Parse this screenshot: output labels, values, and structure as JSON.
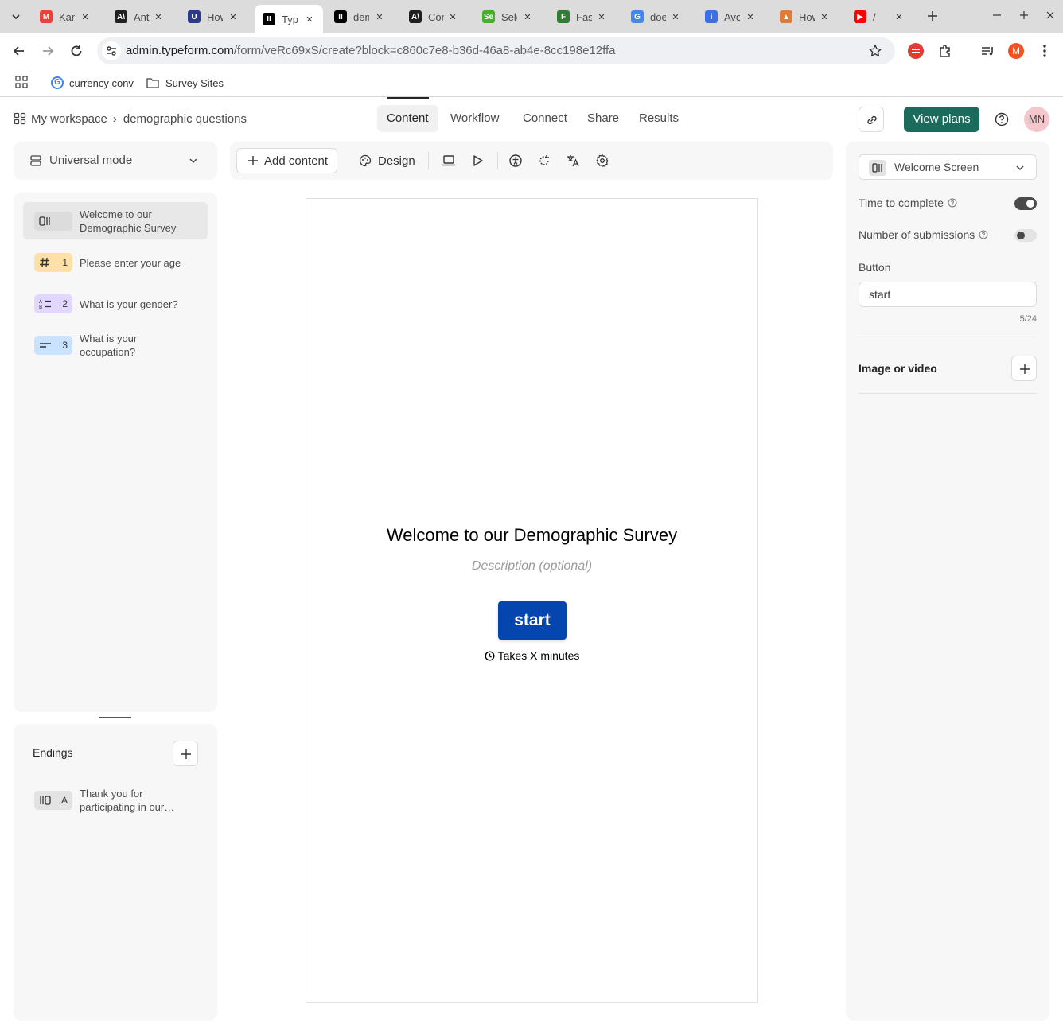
{
  "browser": {
    "tabs": [
      {
        "title": "Kan",
        "fav": "M",
        "color": "#ea4335"
      },
      {
        "title": "Antl",
        "fav": "A\\",
        "color": "#1f1f1f"
      },
      {
        "title": "How",
        "fav": "U",
        "color": "#2b3a8c"
      },
      {
        "title": "Typ",
        "fav": "II",
        "color": "#000000"
      },
      {
        "title": "dem",
        "fav": "II",
        "color": "#000000"
      },
      {
        "title": "Con",
        "fav": "A\\",
        "color": "#1f1f1f"
      },
      {
        "title": "Sele",
        "fav": "Se",
        "color": "#43b02a"
      },
      {
        "title": "Fast",
        "fav": "F",
        "color": "#2e7d32"
      },
      {
        "title": "doe",
        "fav": "G",
        "color": "#4285f4"
      },
      {
        "title": "Avo",
        "fav": "i",
        "color": "#3b6ee8"
      },
      {
        "title": "How",
        "fav": "▲",
        "color": "#e07b39"
      },
      {
        "title": "/",
        "fav": "▶",
        "color": "#ff0000"
      }
    ],
    "url_host": "admin.typeform.com",
    "url_path": "/form/veRc69xS/create?block=c860c7e8-b36d-46a8-ab4e-8cc198e12ffa",
    "bookmarks": [
      {
        "label": "currency conv"
      },
      {
        "label": "Survey Sites"
      }
    ],
    "profile_initial": "M"
  },
  "header": {
    "workspace": "My workspace",
    "form_name": "demographic questions",
    "nav": [
      "Content",
      "Workflow",
      "Connect",
      "Share",
      "Results"
    ],
    "view_plans": "View plans",
    "avatar": "MN"
  },
  "sidebar": {
    "mode": "Universal mode",
    "blocks": [
      {
        "num": "",
        "label_line1": "Welcome to our",
        "label_line2": "Demographic Survey"
      },
      {
        "num": "1",
        "label_line1": "Please enter your age",
        "label_line2": ""
      },
      {
        "num": "2",
        "label_line1": "What is your gender?",
        "label_line2": ""
      },
      {
        "num": "3",
        "label_line1": "What is your",
        "label_line2": "occupation?"
      }
    ],
    "endings_title": "Endings",
    "endings": [
      {
        "num": "A",
        "label_line1": "Thank you for",
        "label_line2": "participating in our…"
      }
    ]
  },
  "editor_toolbar": {
    "add_content": "Add content",
    "design": "Design"
  },
  "preview": {
    "title": "Welcome to our Demographic Survey",
    "description": "Description (optional)",
    "button": "start",
    "time_text": "Takes X minutes"
  },
  "settings": {
    "block_type": "Welcome Screen",
    "time_to_complete": "Time to complete",
    "time_to_complete_on": true,
    "number_of_submissions": "Number of submissions",
    "number_of_submissions_on": false,
    "button_label": "Button",
    "button_value": "start",
    "char_count": "5/24",
    "image_or_video": "Image or video"
  },
  "colors": {
    "accent_green": "#1a6b5c",
    "start_button": "#0445af",
    "badge_welcome": "#e3e3e3",
    "badge_number": "#ffe1a8",
    "badge_multi": "#e2d8ff",
    "badge_text": "#c9e2ff"
  }
}
